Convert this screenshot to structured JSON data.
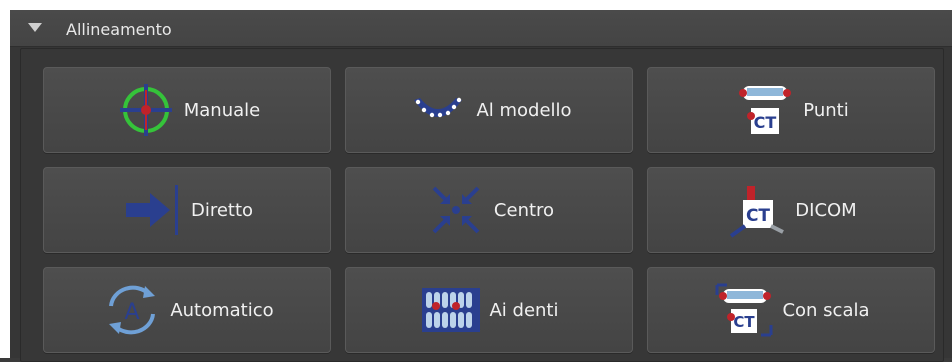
{
  "panel": {
    "title": "Allineamento",
    "buttons": [
      {
        "label": "Manuale",
        "icon": "crosshair-target-icon"
      },
      {
        "label": "Al modello",
        "icon": "dental-arch-dots-icon"
      },
      {
        "label": "Punti",
        "icon": "ct-points-icon"
      },
      {
        "label": "Diretto",
        "icon": "arrow-to-line-icon"
      },
      {
        "label": "Centro",
        "icon": "arrows-to-center-icon"
      },
      {
        "label": "DICOM",
        "icon": "ct-dicom-icon"
      },
      {
        "label": "Automatico",
        "icon": "auto-rotate-a-icon"
      },
      {
        "label": "Ai denti",
        "icon": "teeth-points-icon"
      },
      {
        "label": "Con scala",
        "icon": "ct-scale-icon"
      }
    ]
  },
  "colors": {
    "accent_blue": "#2a3f8f",
    "point_red": "#c0232a",
    "green": "#35c33a"
  }
}
